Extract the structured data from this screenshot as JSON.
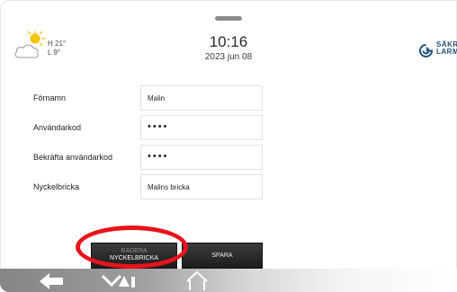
{
  "weather": {
    "high": "H 21°",
    "low": "L 9°",
    "icon": "partly-cloudy-icon"
  },
  "clock": {
    "time": "10:16",
    "date": "2023 jun 08"
  },
  "brand": {
    "line1": "SÄKR",
    "line2": "LARM",
    "color": "#1f4e79"
  },
  "form": {
    "rows": [
      {
        "label": "Förnamn",
        "value": "Malin"
      },
      {
        "label": "Användarkod",
        "value": "••••"
      },
      {
        "label": "Bekräfta användarkod",
        "value": "••••"
      },
      {
        "label": "Nyckelbricka",
        "value": "Malins bricka"
      }
    ]
  },
  "buttons": {
    "delete_line1": "RADERA",
    "delete_line2": "NYCKELBRICKA",
    "save": "SPARA"
  },
  "nav": {
    "icons": [
      "back-arrow-icon",
      "alarm-status-icon",
      "home-icon"
    ]
  },
  "colors": {
    "annotation": "#e8141b",
    "button": "#2a2a2a"
  }
}
